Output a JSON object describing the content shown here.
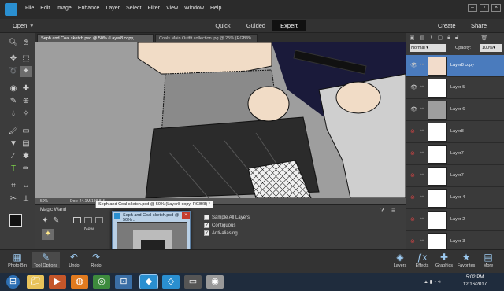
{
  "app": {
    "menus": [
      "File",
      "Edit",
      "Image",
      "Enhance",
      "Layer",
      "Select",
      "Filter",
      "View",
      "Window",
      "Help"
    ]
  },
  "modes": {
    "open": "Open",
    "quick": "Quick",
    "guided": "Guided",
    "expert": "Expert",
    "create": "Create",
    "share": "Share"
  },
  "tabs": [
    {
      "label": "Seph and Coal sketch.psd @ 50% (Layer8 copy, RGB/8) *"
    },
    {
      "label": "Coals Main Outfit collection.jpg @ 25% (RGB/8)"
    }
  ],
  "status": {
    "zoom": "50%",
    "doc": "Doc: 24.1M/198.8M"
  },
  "tooloptions": {
    "tool_name": "Magic Wand",
    "new_label": "New",
    "sample_all": "Sample All Layers",
    "contiguous": "Contiguous",
    "antialias": "Anti-aliasing"
  },
  "tooltip": "Seph and Coal sketch.psd @ 50% (Layer8 copy, RGB/8) *",
  "preview": {
    "title": "Seph and Coal sketch.psd @ 50%..."
  },
  "layers_panel": {
    "blend": "Normal",
    "opacity_label": "Opacity:",
    "opacity": "100%",
    "layers": [
      "Layer8 copy",
      "Layer 5",
      "Layer 6",
      "Layer8",
      "Layer7",
      "Layer7",
      "Layer 4",
      "Layer 2",
      "Layer 3"
    ]
  },
  "bottombar": {
    "photo_bin": "Photo Bin",
    "tool_options": "Tool Options",
    "undo": "Undo",
    "redo": "Redo",
    "layers": "Layers",
    "effects": "Effects",
    "graphics": "Graphics",
    "favorites": "Favorites",
    "more": "More"
  },
  "clock": {
    "time": "5:02 PM",
    "date": "12/16/2017"
  },
  "colors": {
    "accent": "#2a8fd0",
    "selected_layer": "#4a7bbd",
    "canvas": "#9e9e9e"
  }
}
